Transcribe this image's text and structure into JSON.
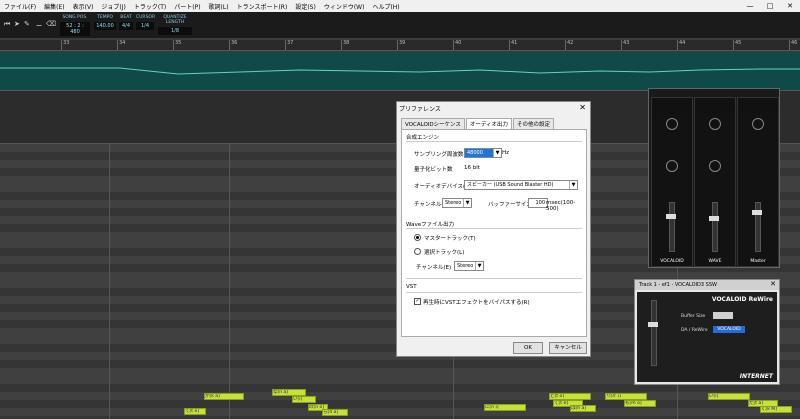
{
  "menu": [
    "ファイル(F)",
    "編集(E)",
    "表示(V)",
    "ジョブ(J)",
    "トラック(T)",
    "パート(P)",
    "歌詞(L)",
    "トランスポート(R)",
    "設定(S)",
    "ウィンドウ(W)",
    "ヘルプ(H)"
  ],
  "toolbar": {
    "song_pos_label": "SONG POS.",
    "song_pos": "52 : 2 : 480",
    "tempo_label": "TEMPO",
    "tempo": "140.00",
    "beat_label": "BEAT",
    "beat": "4/4",
    "cursor_label": "CURSOR",
    "cursor": "1/4",
    "quantize_label": "QUANTIZE LENGTH",
    "quantize": "1/8"
  },
  "ruler_marks": [
    "33",
    "34",
    "35",
    "36",
    "37",
    "38",
    "39",
    "40",
    "41",
    "42",
    "43",
    "44",
    "45",
    "46"
  ],
  "dialog": {
    "title": "プリファレンス",
    "tabs": [
      "VOCALOIDシーケンス",
      "オーディオ出力",
      "その他の設定"
    ],
    "active_tab": 1,
    "synth_section": "合成エンジン",
    "sampling_label": "サンプリング周波数(S)",
    "sampling_value": "48000",
    "sampling_unit": "Hz",
    "bitdepth_label": "量子化ビット数",
    "bitdepth_value": "16 bit",
    "device_label": "オーディオデバイス(D)",
    "device_value": "スピーカー (USB Sound Blaster HD)",
    "channel_label": "チャンネル(C)",
    "channel_value": "Stereo",
    "buffer_label": "バッファーサイズ",
    "buffer_value": "100",
    "buffer_unit": "msec(100-500)",
    "wave_section": "Waveファイル出力",
    "master_track": "マスタートラック(T)",
    "selected_track": "選択トラック(L)",
    "wave_channel_label": "チャンネル(E)",
    "wave_channel_value": "Stereo",
    "vst_section": "VST",
    "vst_check": "再生時にVSTエフェクトをバイパスする(R)",
    "ok": "OK",
    "cancel": "キャンセル"
  },
  "mixer": {
    "strips": [
      {
        "name": "VOCALOID",
        "color": "#1e8bd6"
      },
      {
        "name": "WAVE",
        "color": "#1e8bd6"
      },
      {
        "name": "Master",
        "color": "#1e8bd6"
      }
    ]
  },
  "vst": {
    "title": "Track 1 - ef1 - VOCALOID3 SSW",
    "product": "VOCALOID ReWire",
    "buffer_label": "Buffer Size",
    "input_label": "DA / ReWire",
    "input_value": "VOCALOID",
    "brand": "INTERNET"
  },
  "notes": [
    {
      "text": "か[k a]"
    },
    {
      "text": "な[n a]"
    },
    {
      "text": "い[i]"
    },
    {
      "text": "て[t e]"
    },
    {
      "text": "の[n o]"
    },
    {
      "text": "ら[4 a]"
    },
    {
      "text": "に[n i]"
    },
    {
      "text": "と[t o]"
    },
    {
      "text": "て[t e]"
    },
    {
      "text": "は[h a]"
    },
    {
      "text": "り[4' i]"
    },
    {
      "text": "も[m o]"
    },
    {
      "text": "い[i]"
    },
    {
      "text": "た[t a]"
    },
    {
      "text": "く[k M]"
    }
  ]
}
